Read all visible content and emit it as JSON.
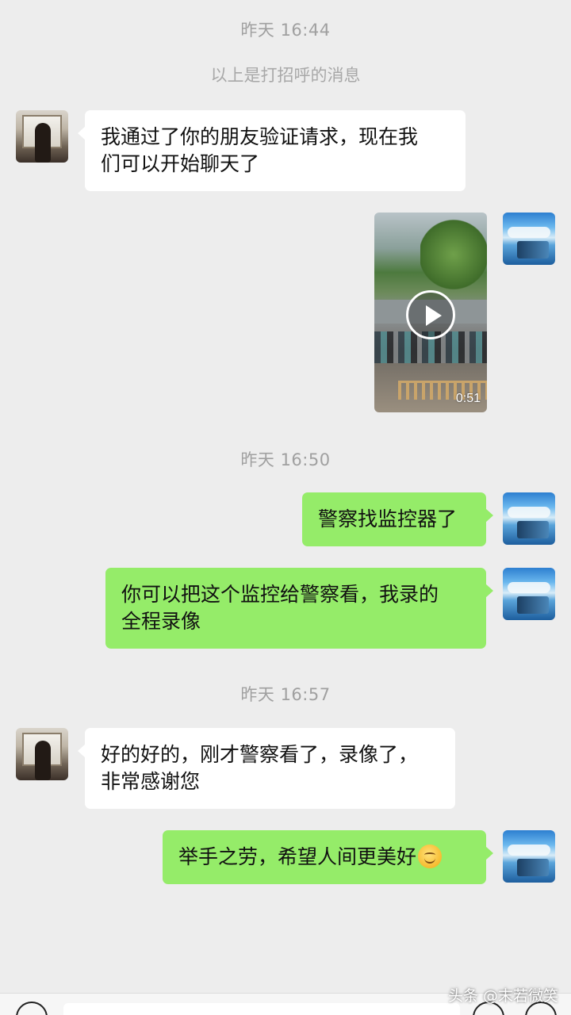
{
  "chat": {
    "timestamps": [
      "昨天 16:44",
      "昨天 16:50",
      "昨天 16:57"
    ],
    "system_notice": "以上是打招呼的消息",
    "messages": [
      {
        "from": "them",
        "text_line1": "我通过了你的朋友验证请求，现在我",
        "text_line2": "们可以开始聊天了"
      },
      {
        "from": "me",
        "type": "video",
        "duration": "0:51"
      },
      {
        "from": "me",
        "text": "警察找监控器了"
      },
      {
        "from": "me",
        "text_line1": "你可以把这个监控给警察看，我录的",
        "text_line2": "全程录像"
      },
      {
        "from": "them",
        "text_line1": "好的好的，刚才警察看了，录像了，",
        "text_line2": "非常感谢您"
      },
      {
        "from": "me",
        "text": "举手之劳，希望人间更美好",
        "emoji": "smile-emoji"
      }
    ]
  },
  "watermark": "头条 @末若微笑",
  "colors": {
    "background": "#ededed",
    "my_bubble": "#95ec69",
    "their_bubble": "#ffffff",
    "timestamp": "#a0a0a0"
  }
}
